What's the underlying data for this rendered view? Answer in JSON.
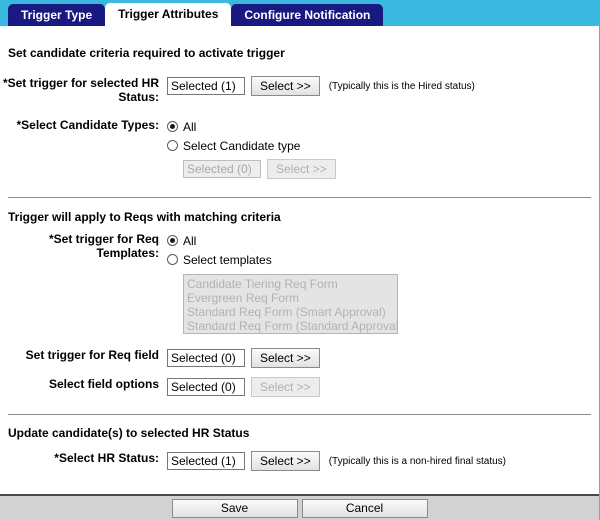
{
  "tabs": [
    {
      "label": "Trigger Type",
      "active": false
    },
    {
      "label": "Trigger Attributes",
      "active": true
    },
    {
      "label": "Configure Notification",
      "active": false
    }
  ],
  "section1": {
    "title": "Set candidate criteria required to activate trigger",
    "hr_status": {
      "label": "*Set trigger for selected HR Status:",
      "value": "Selected (1)",
      "button": "Select >>",
      "hint": "(Typically this is the Hired status)"
    },
    "candidate_types": {
      "label": "*Select Candidate Types:",
      "option_all": "All",
      "option_select": "Select Candidate type",
      "selected_option": "All",
      "value": "Selected (0)",
      "button": "Select >>"
    }
  },
  "section2": {
    "title": "Trigger will apply to Reqs with matching criteria",
    "req_templates": {
      "label": "*Set trigger for Req Templates:",
      "option_all": "All",
      "option_select": "Select templates",
      "selected_option": "All",
      "options": [
        "Candidate Tiering Req Form",
        "Evergreen Req Form",
        "Standard Req Form (Smart Approval)",
        "Standard Req Form (Standard Approval)"
      ]
    },
    "req_field": {
      "label": "Set trigger for Req field",
      "value": "Selected (0)",
      "button": "Select >>"
    },
    "field_options": {
      "label": "Select field options",
      "value": "Selected (0)",
      "button": "Select >>"
    }
  },
  "section3": {
    "title": "Update candidate(s) to selected HR Status",
    "hr_status": {
      "label": "*Select HR Status:",
      "value": "Selected (1)",
      "button": "Select >>",
      "hint": "(Typically this is a non-hired final status)"
    }
  },
  "footer": {
    "save": "Save",
    "cancel": "Cancel"
  }
}
